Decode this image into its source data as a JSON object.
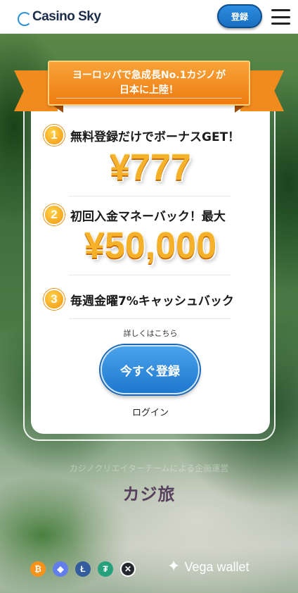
{
  "header": {
    "logo_text": "Casino Sky",
    "register_label": "登録"
  },
  "banner": {
    "line1": "ヨーロッパで急成長No.1カジノが",
    "line2": "日本に上陸！"
  },
  "offers": [
    {
      "number": "1",
      "label": "無料登録だけでボーナスGET！",
      "amount": "¥777"
    },
    {
      "number": "2",
      "label": "初回入金マネーバック！最大",
      "amount": "¥50,000"
    },
    {
      "number": "3",
      "label": "毎週金曜7%キャッシュバック"
    }
  ],
  "details_text": "詳しくはこちら",
  "cta_label": "今すぐ登録",
  "login_label": "ログイン",
  "credit": {
    "text": "カジノクリエイターチームによる企画運営",
    "logo": "カジ旅"
  },
  "payments": [
    {
      "icon": "bitcoin-icon",
      "symbol": "₿",
      "color": "#f7931a"
    },
    {
      "icon": "ethereum-icon",
      "symbol": "◆",
      "color": "#627eea"
    },
    {
      "icon": "litecoin-icon",
      "symbol": "Ł",
      "color": "#345d9d"
    },
    {
      "icon": "tether-icon",
      "symbol": "₮",
      "color": "#26a17b"
    },
    {
      "icon": "xrp-icon",
      "symbol": "✕",
      "color": "#23292f"
    }
  ],
  "vega": {
    "label": "Vega wallet"
  }
}
